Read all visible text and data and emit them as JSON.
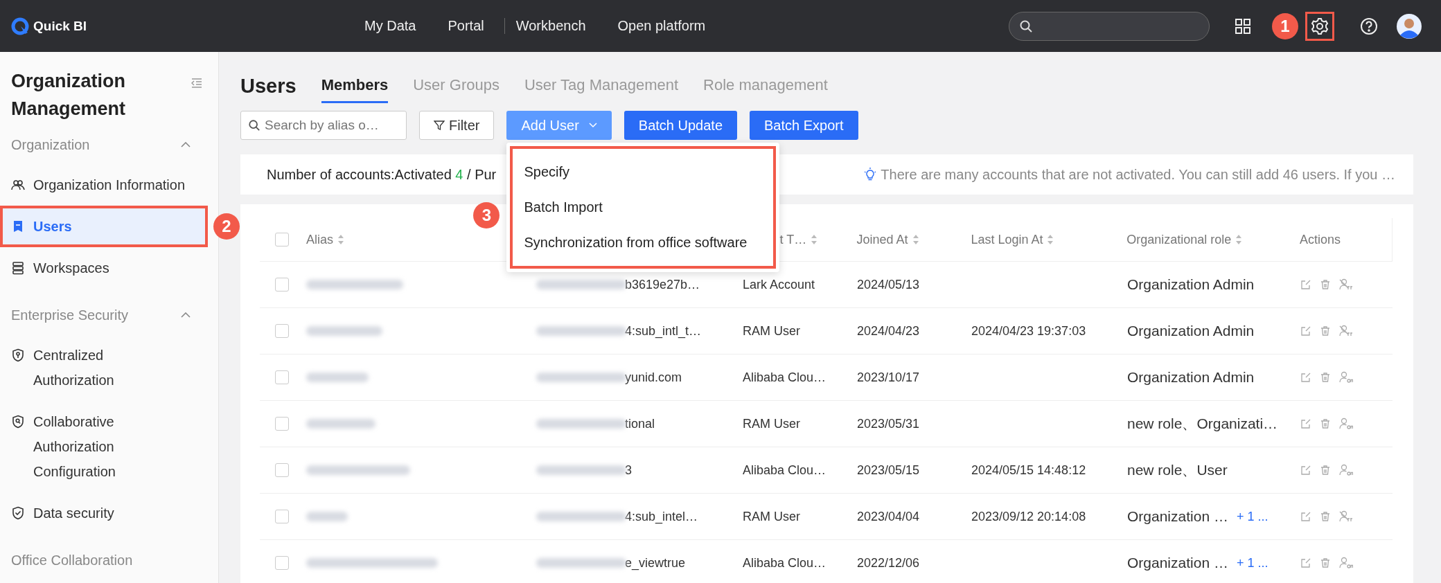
{
  "topbar": {
    "logo": "Quick BI",
    "nav": [
      {
        "label": "My Data",
        "divider_before": false
      },
      {
        "label": "Portal",
        "divider_before": false
      },
      {
        "label": "Workbench",
        "divider_before": true
      },
      {
        "label": "Open platform",
        "divider_before": false
      }
    ],
    "settings": {
      "highlighted": true,
      "marker": "1"
    }
  },
  "sidebar": {
    "title": "Organization Management",
    "sections": [
      {
        "title": "Organization",
        "expanded": true,
        "items": [
          {
            "label": "Organization Information",
            "selected": false,
            "highlighted": false
          },
          {
            "label": "Users",
            "selected": true,
            "highlighted": true,
            "marker": "2"
          },
          {
            "label": "Workspaces",
            "selected": false,
            "highlighted": false
          }
        ]
      },
      {
        "title": "Enterprise Security",
        "expanded": true,
        "items": [
          {
            "label": "Centralized Authorization",
            "selected": false,
            "highlighted": false
          },
          {
            "label": "Collaborative Authorization Configuration",
            "selected": false,
            "highlighted": false
          },
          {
            "label": "Data security",
            "selected": false,
            "highlighted": false
          }
        ]
      },
      {
        "title": "Office Collaboration"
      }
    ]
  },
  "page_title": "Users",
  "tabs": [
    {
      "label": "Members",
      "selected": true
    },
    {
      "label": "User Groups",
      "selected": false
    },
    {
      "label": "User Tag Management",
      "selected": false
    },
    {
      "label": "Role management",
      "selected": false
    }
  ],
  "search": {
    "placeholder": "Search by alias o…"
  },
  "buttons": [
    {
      "label": "Filter",
      "kind": "filter"
    },
    {
      "label": "Add User",
      "kind": "dropdown"
    },
    {
      "label": "Batch Update",
      "kind": "primary"
    },
    {
      "label": "Batch Export",
      "kind": "primary"
    }
  ],
  "add_user_menu": {
    "open": true,
    "highlighted": true,
    "marker": "3",
    "items": [
      {
        "label": "Specify"
      },
      {
        "label": "Batch Import"
      },
      {
        "label": "Synchronization from office software"
      }
    ]
  },
  "info": {
    "label": "Number of accounts:Activated",
    "activated": "4",
    "rest": "/ Pur",
    "hint": "There are many accounts that are not activated. You can still add 46 users. If you …"
  },
  "table": {
    "select_all_checked": false,
    "columns": [
      {
        "label": "Alias",
        "sortable": true,
        "kind": "full"
      },
      {
        "label": "t T…",
        "sortable": true,
        "kind": "partial"
      },
      {
        "label": "Joined At",
        "sortable": true,
        "kind": "full"
      },
      {
        "label": "Last Login At",
        "sortable": true,
        "kind": "full"
      },
      {
        "label": "Organizational role",
        "sortable": true,
        "kind": "full"
      },
      {
        "label": "Actions",
        "sortable": false,
        "kind": "full"
      }
    ],
    "rows": [
      {
        "checked": false,
        "account": "b3619e27b…",
        "type": "Lark Account",
        "joined": "2024/05/13",
        "role": "Organization Admin",
        "enabled": false
      },
      {
        "checked": false,
        "account": "4:sub_intl_t…",
        "type": "RAM User",
        "joined": "2024/04/23",
        "last_login": "2024/04/23 19:37:03",
        "role": "Organization Admin",
        "enabled": false
      },
      {
        "checked": false,
        "account": "yunid.com",
        "type": "Alibaba Clou…",
        "joined": "2023/10/17",
        "role": "Organization Admin",
        "enabled": true
      },
      {
        "checked": false,
        "account": "tional",
        "type": "RAM User",
        "joined": "2023/05/31",
        "role": "new role、Organizati…",
        "enabled": true
      },
      {
        "checked": false,
        "account": "3",
        "type": "Alibaba Clou…",
        "joined": "2023/05/15",
        "last_login": "2024/05/15 14:48:12",
        "role": "new role、User",
        "enabled": true
      },
      {
        "checked": false,
        "account": "4:sub_intel…",
        "type": "RAM User",
        "joined": "2023/04/04",
        "last_login": "2023/09/12 20:14:08",
        "role": "Organization …",
        "role_more": "+ 1 ...",
        "enabled": false
      },
      {
        "checked": false,
        "account": "e_viewtrue",
        "type": "Alibaba Clou…",
        "joined": "2022/12/06",
        "role": "Organization …",
        "role_more": "+ 1 ...",
        "enabled": true
      }
    ]
  }
}
